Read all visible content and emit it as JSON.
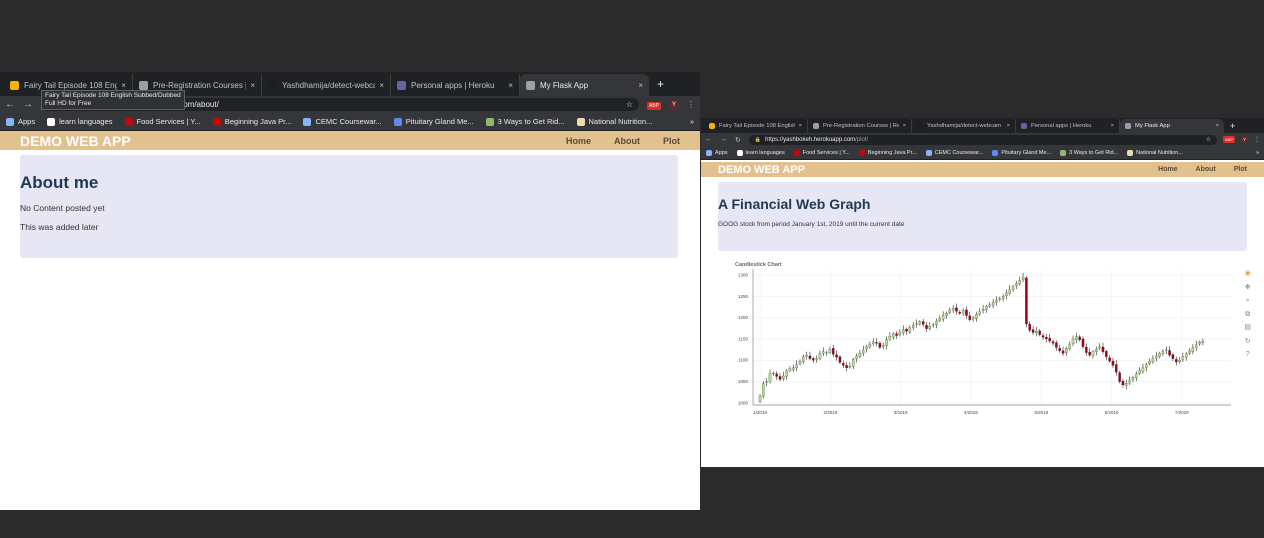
{
  "left": {
    "tabs": [
      {
        "title": "Fairy Tail Episode 108 English",
        "favicon_color": "#f4b400",
        "active": false
      },
      {
        "title": "Pre-Registration Courses | Re",
        "favicon_color": "#9aa0a6",
        "active": false
      },
      {
        "title": "Yashdhamija/detect-webcam",
        "favicon_color": "#1b1f23",
        "active": false
      },
      {
        "title": "Personal apps | Heroku",
        "favicon_color": "#6762a6",
        "active": false
      },
      {
        "title": "My Flask App",
        "favicon_color": "#9aa0a6",
        "active": true
      }
    ],
    "newtab": "+",
    "address": {
      "hidden_part": "",
      "path": ".com/about/"
    },
    "tooltip": [
      "Fairy Tail Episode 108 English Subbed/Dubbed",
      "Full HD for Free"
    ],
    "bookmarks": [
      {
        "label": "Apps",
        "icon_color": "#8ab4f8"
      },
      {
        "label": "learn languages",
        "icon_color": "#ffffff"
      },
      {
        "label": "Food Services | Y...",
        "icon_color": "#c5050c"
      },
      {
        "label": "Beginning Java Pr...",
        "icon_color": "#c5050c"
      },
      {
        "label": "CEMC Coursewar...",
        "icon_color": "#8ab4f8"
      },
      {
        "label": "Pituitary Gland Me...",
        "icon_color": "#5b8def"
      },
      {
        "label": "3 Ways to Get Rid...",
        "icon_color": "#93b874"
      },
      {
        "label": "National Nutrition...",
        "icon_color": "#e8dcb0"
      }
    ],
    "bookmarks_more": "»",
    "app": {
      "brand": "DEMO WEB APP",
      "nav": [
        "Home",
        "About",
        "Plot"
      ],
      "heading": "About me",
      "lines": [
        "No Content posted yet",
        "This was added later"
      ]
    }
  },
  "right": {
    "tabs": [
      {
        "title": "Fairy Tail Episode 108 English",
        "favicon_color": "#f4b400",
        "active": false
      },
      {
        "title": "Pre-Registration Courses | Re",
        "favicon_color": "#9aa0a6",
        "active": false
      },
      {
        "title": "Yashdhamija/detect-webcam",
        "favicon_color": "#1b1f23",
        "active": false
      },
      {
        "title": "Personal apps | Heroku",
        "favicon_color": "#6762a6",
        "active": false
      },
      {
        "title": "My Flask App",
        "favicon_color": "#9aa0a6",
        "active": true
      }
    ],
    "newtab": "+",
    "address": {
      "host": "https://yashbokeh.herokuapp.com",
      "path": "/plot/"
    },
    "bookmarks": [
      {
        "label": "Apps",
        "icon_color": "#8ab4f8"
      },
      {
        "label": "learn languages",
        "icon_color": "#ffffff"
      },
      {
        "label": "Food Services | Y...",
        "icon_color": "#c5050c"
      },
      {
        "label": "Beginning Java Pr...",
        "icon_color": "#c5050c"
      },
      {
        "label": "CEMC Coursewar...",
        "icon_color": "#8ab4f8"
      },
      {
        "label": "Pituitary Gland Me...",
        "icon_color": "#5b8def"
      },
      {
        "label": "3 Ways to Get Rid...",
        "icon_color": "#93b874"
      },
      {
        "label": "National Nutrition...",
        "icon_color": "#e8dcb0"
      }
    ],
    "bookmarks_more": "»",
    "app": {
      "brand": "DEMO WEB APP",
      "nav": [
        "Home",
        "About",
        "Plot"
      ],
      "heading": "A Financial Web Graph",
      "description": "GOOG stock from period January 1st, 2019 until the current date"
    },
    "chart_tools": [
      "bokeh-logo-icon",
      "pan-icon",
      "wheel-zoom-icon",
      "box-zoom-icon",
      "save-icon",
      "reset-icon",
      "help-icon"
    ]
  },
  "icons": {
    "back": "←",
    "forward": "→",
    "reload": "↻",
    "star": "☆",
    "menu": "⋮",
    "close": "×",
    "lock": "🔒",
    "apps": "▦",
    "profile_letter": "Y",
    "adblock": "ABP"
  },
  "chart_data": {
    "type": "candlestick",
    "title": "Candlestick Chart",
    "xlabel": "",
    "ylabel": "",
    "ylim": [
      995,
      1300
    ],
    "yticks": [
      1000,
      1050,
      1100,
      1150,
      1200,
      1250,
      1300
    ],
    "xticks": [
      "1/2019",
      "2/2019",
      "3/2019",
      "4/2019",
      "5/2019",
      "6/2019",
      "7/2019"
    ],
    "xlim_months": [
      0.9,
      7.7
    ],
    "colors": {
      "increasing": "#b2df8a",
      "decreasing": "#a6001a",
      "wick": "#000000"
    },
    "closes": [
      1016,
      1045,
      1050,
      1068,
      1070,
      1062,
      1055,
      1063,
      1075,
      1080,
      1082,
      1090,
      1098,
      1108,
      1112,
      1104,
      1100,
      1105,
      1115,
      1120,
      1118,
      1126,
      1114,
      1107,
      1095,
      1088,
      1082,
      1086,
      1102,
      1110,
      1116,
      1124,
      1132,
      1138,
      1144,
      1140,
      1130,
      1135,
      1148,
      1156,
      1162,
      1158,
      1165,
      1172,
      1168,
      1176,
      1182,
      1186,
      1190,
      1184,
      1174,
      1180,
      1184,
      1192,
      1198,
      1205,
      1210,
      1218,
      1222,
      1215,
      1210,
      1216,
      1205,
      1195,
      1200,
      1208,
      1214,
      1220,
      1226,
      1230,
      1236,
      1240,
      1245,
      1250,
      1258,
      1266,
      1273,
      1280,
      1288,
      1295,
      1185,
      1170,
      1165,
      1168,
      1160,
      1154,
      1150,
      1145,
      1140,
      1130,
      1122,
      1116,
      1128,
      1138,
      1150,
      1155,
      1148,
      1132,
      1118,
      1112,
      1120,
      1126,
      1132,
      1120,
      1108,
      1098,
      1088,
      1072,
      1050,
      1042,
      1046,
      1052,
      1060,
      1068,
      1076,
      1082,
      1090,
      1098,
      1104,
      1110,
      1116,
      1120,
      1124,
      1112,
      1104,
      1096,
      1100,
      1108,
      1115,
      1122,
      1130,
      1136,
      1142,
      1145
    ]
  }
}
